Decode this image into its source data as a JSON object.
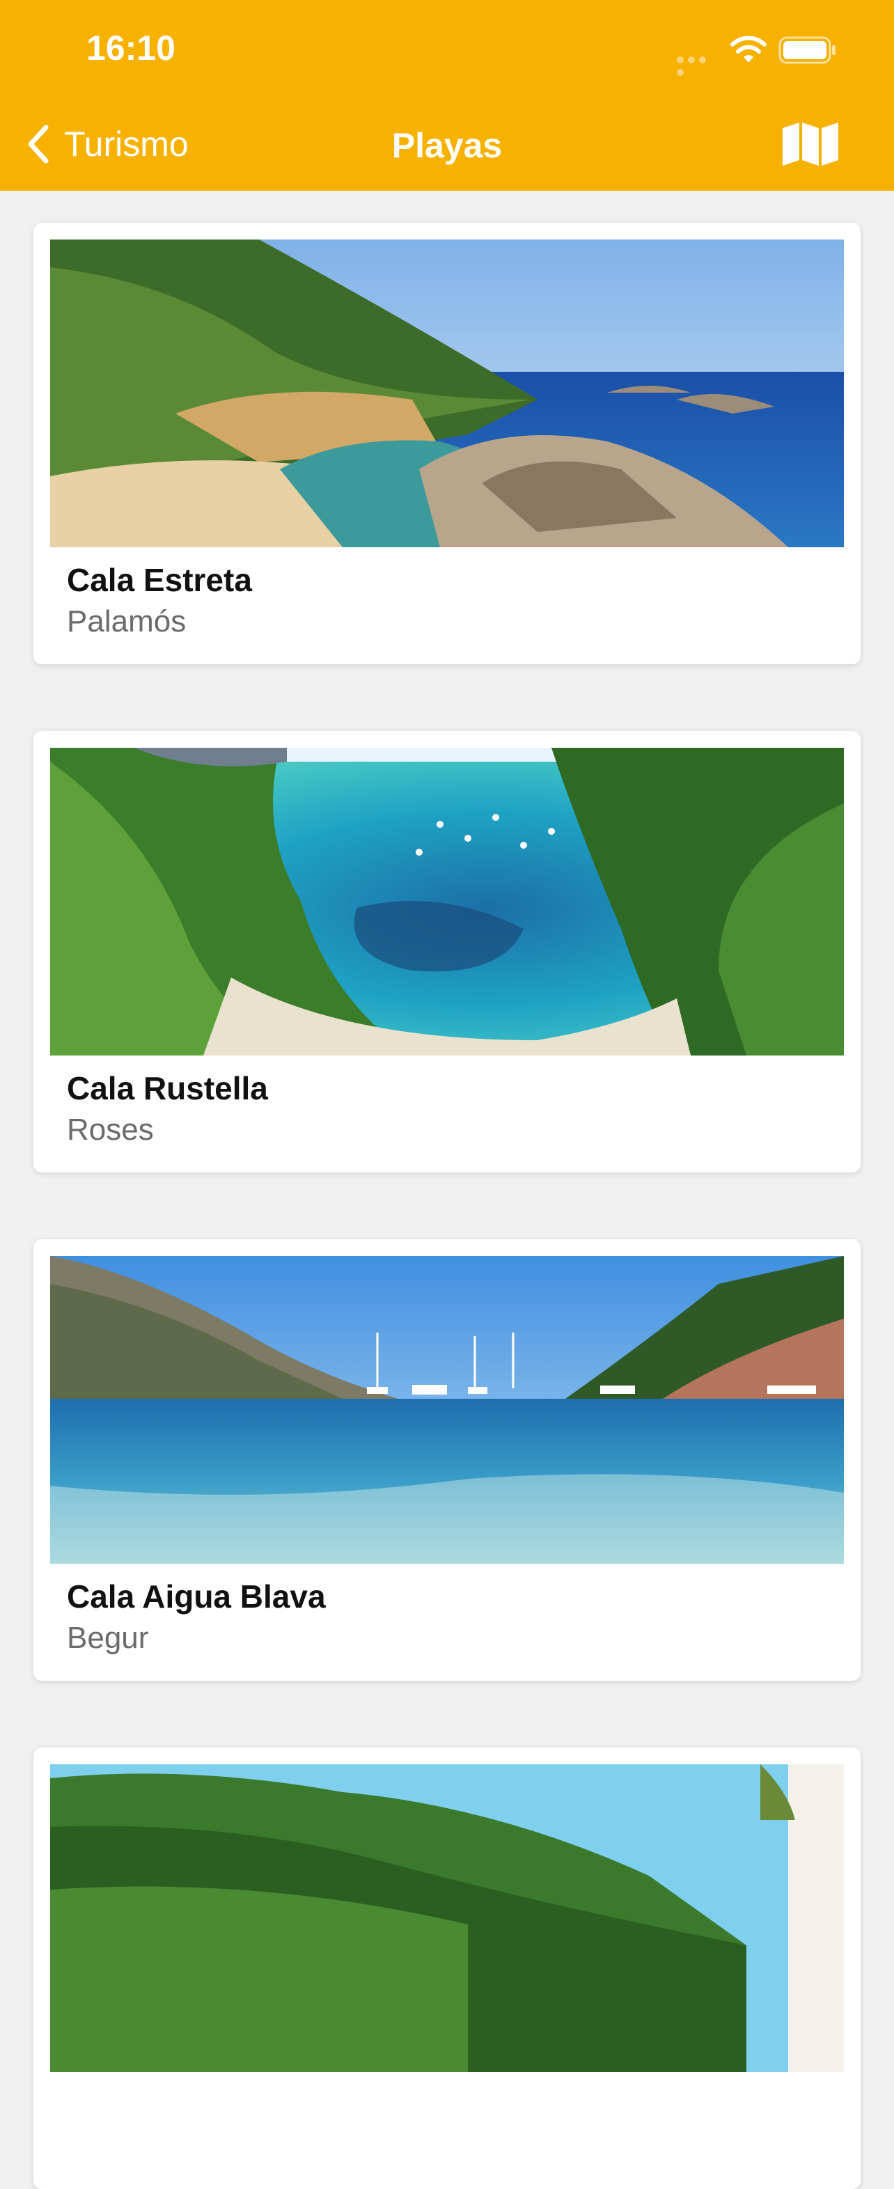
{
  "status_bar": {
    "time": "16:10"
  },
  "nav": {
    "back_label": "Turismo",
    "title": "Playas",
    "map_icon": "map-icon"
  },
  "colors": {
    "accent": "#f7b100",
    "card_bg": "#ffffff",
    "page_bg": "#f0f0f0"
  },
  "beaches": [
    {
      "name": "Cala Estreta",
      "town": "Palamós"
    },
    {
      "name": "Cala Rustella",
      "town": "Roses"
    },
    {
      "name": "Cala Aigua Blava",
      "town": "Begur"
    },
    {
      "name": "",
      "town": ""
    }
  ]
}
